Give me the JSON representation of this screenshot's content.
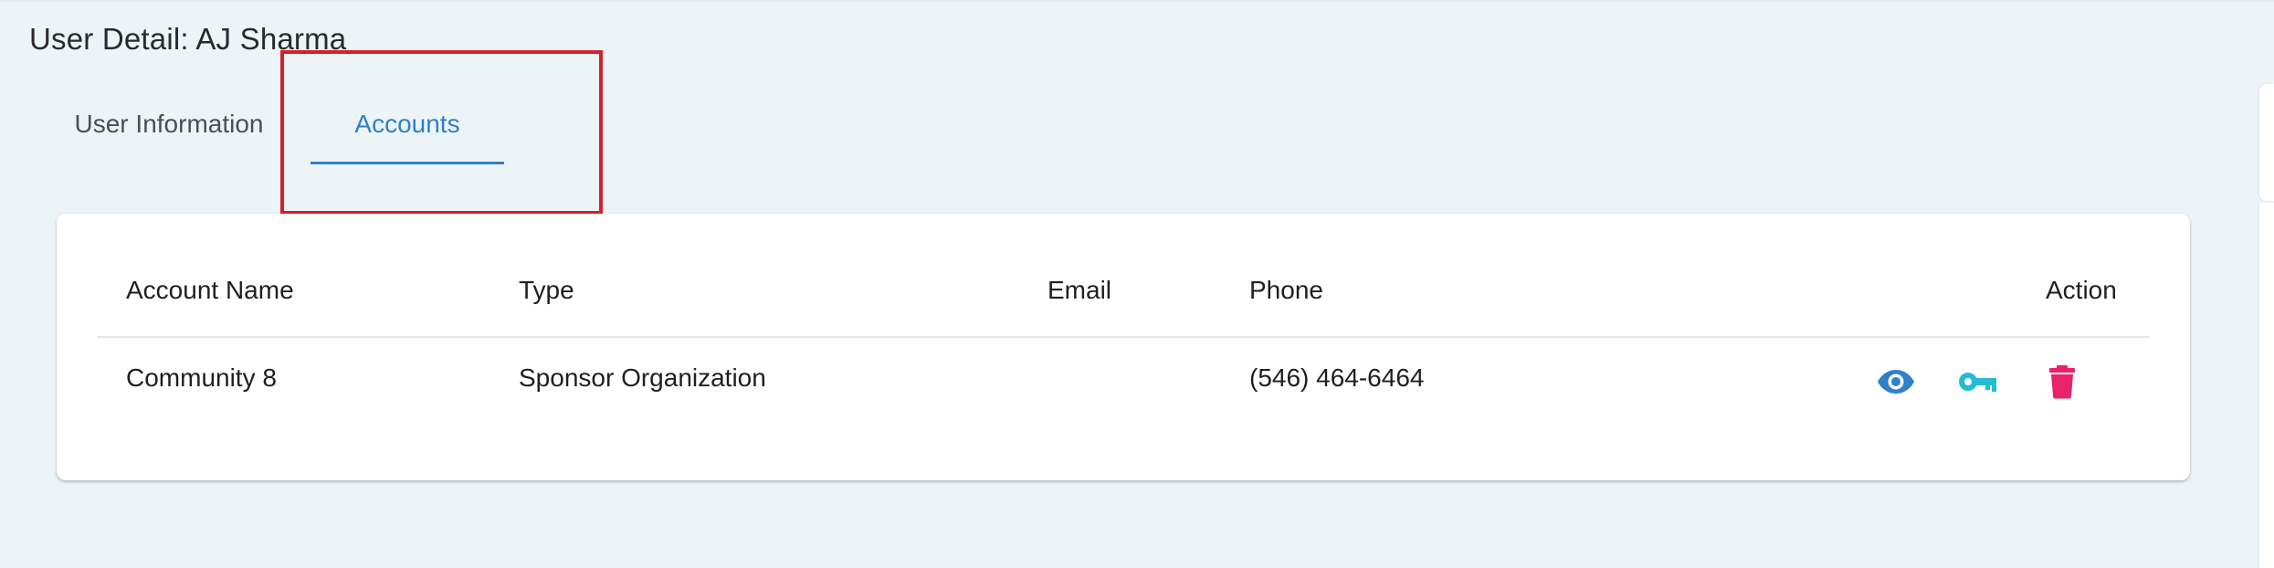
{
  "page": {
    "title": "User Detail: AJ Sharma"
  },
  "tabs": [
    {
      "label": "User Information",
      "active": false
    },
    {
      "label": "Accounts",
      "active": true
    }
  ],
  "table": {
    "columns": [
      "Account Name",
      "Type",
      "Email",
      "Phone",
      "Action"
    ],
    "rows": [
      {
        "account_name": "Community 8",
        "type": "Sponsor Organization",
        "email": "",
        "phone": "(546) 464-6464",
        "actions": [
          {
            "icon": "eye-icon",
            "color": "#2f80c9"
          },
          {
            "icon": "key-icon",
            "color": "#22bcd4"
          },
          {
            "icon": "trash-icon",
            "color": "#e8236a"
          }
        ]
      }
    ]
  },
  "colors": {
    "background": "#edf4f8",
    "accent": "#2f80c9",
    "highlight_border": "#d62029",
    "key_icon": "#22bcd4",
    "delete_icon": "#e8236a"
  }
}
